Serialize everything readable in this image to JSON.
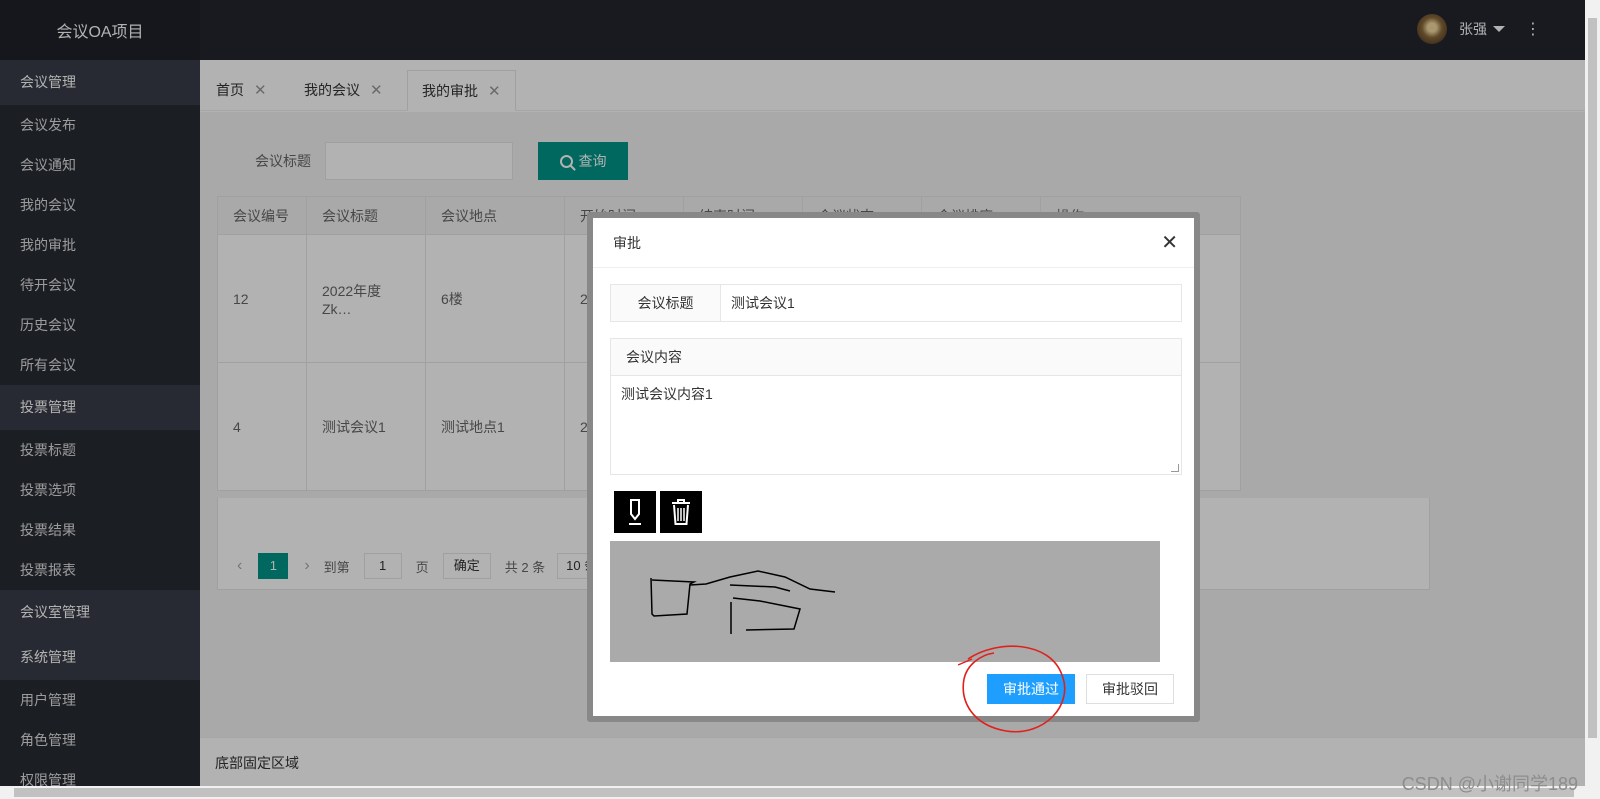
{
  "app_title": "会议OA项目",
  "header": {
    "username": "张强",
    "more_icon": "⋮"
  },
  "sidebar": {
    "groups": [
      {
        "title": "会议管理",
        "items": [
          "会议发布",
          "会议通知",
          "我的会议",
          "我的审批",
          "待开会议",
          "历史会议",
          "所有会议"
        ]
      },
      {
        "title": "投票管理",
        "items": [
          "投票标题",
          "投票选项",
          "投票结果",
          "投票报表"
        ]
      },
      {
        "title": "会议室管理",
        "items": []
      },
      {
        "title": "系统管理",
        "items": [
          "用户管理",
          "角色管理",
          "权限管理"
        ]
      }
    ]
  },
  "tabs": [
    {
      "label": "首页",
      "close": "✕"
    },
    {
      "label": "我的会议",
      "close": "✕"
    },
    {
      "label": "我的审批",
      "close": "✕"
    }
  ],
  "search": {
    "label": "会议标题",
    "value": "",
    "button": "查询"
  },
  "table": {
    "headers": [
      "会议编号",
      "会议标题",
      "会议地点",
      "开始时间",
      "结束时间",
      "会议状态",
      "会议排座",
      "操作"
    ],
    "rows": [
      [
        "12",
        "2022年度Zk…",
        "6楼",
        "2"
      ],
      [
        "4",
        "测试会议1",
        "测试地点1",
        "2"
      ]
    ]
  },
  "pagination": {
    "prev": "‹",
    "current": "1",
    "next": "›",
    "goto_prefix": "到第",
    "goto_value": "1",
    "goto_suffix": "页",
    "confirm": "确定",
    "total": "共 2 条",
    "page_size": "10 条/页"
  },
  "footer": {
    "text": "底部固定区域"
  },
  "dialog": {
    "title": "审批",
    "close": "✕",
    "title_label": "会议标题",
    "title_value": "测试会议1",
    "content_label": "会议内容",
    "content_value": "测试会议内容1",
    "approve": "审批通过",
    "reject": "审批驳回"
  },
  "watermark": "CSDN @小谢同学189",
  "colors": {
    "primary": "#009688",
    "approve": "#1e9fff",
    "annotation": "#e0201b"
  }
}
